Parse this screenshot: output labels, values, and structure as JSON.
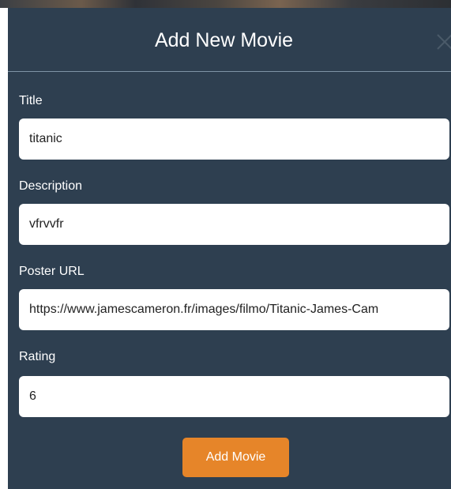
{
  "modal": {
    "title": "Add New Movie",
    "close_icon": "close-icon"
  },
  "form": {
    "fields": [
      {
        "label": "Title",
        "value": "titanic"
      },
      {
        "label": "Description",
        "value": "vfrvvfr"
      },
      {
        "label": "Poster URL",
        "value": "https://www.jamescameron.fr/images/filmo/Titanic-James-Cam"
      },
      {
        "label": "Rating",
        "value": "6"
      }
    ],
    "submit_label": "Add Movie"
  },
  "colors": {
    "modal_background": "#2e3f50",
    "submit_button": "#e68529",
    "text": "#ffffff"
  }
}
